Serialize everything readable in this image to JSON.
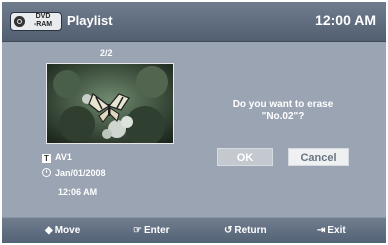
{
  "header": {
    "disc_badge": "DVD\n-RAM",
    "title": "Playlist",
    "time": "12:00 AM"
  },
  "thumbnail": {
    "counter": "2/2",
    "image": "butterfly-on-flowers-photo"
  },
  "info": {
    "source_icon": "T",
    "source": "AV1",
    "date": "Jan/01/2008",
    "time": "12:06 AM"
  },
  "dialog": {
    "prompt_line1": "Do you want to erase",
    "prompt_line2": "\"No.02\"?",
    "ok_label": "OK",
    "cancel_label": "Cancel"
  },
  "footer": {
    "move_icon": "◆",
    "move_label": "Move",
    "enter_icon": "☞",
    "enter_label": "Enter",
    "return_icon": "↺",
    "return_label": "Return",
    "exit_icon": "⇥",
    "exit_label": "Exit"
  },
  "colors": {
    "background": "#9aa4b2",
    "header_bar": "#5f6c7e",
    "ok_button": "#c4c9d0",
    "cancel_button": "#eef0f2"
  }
}
